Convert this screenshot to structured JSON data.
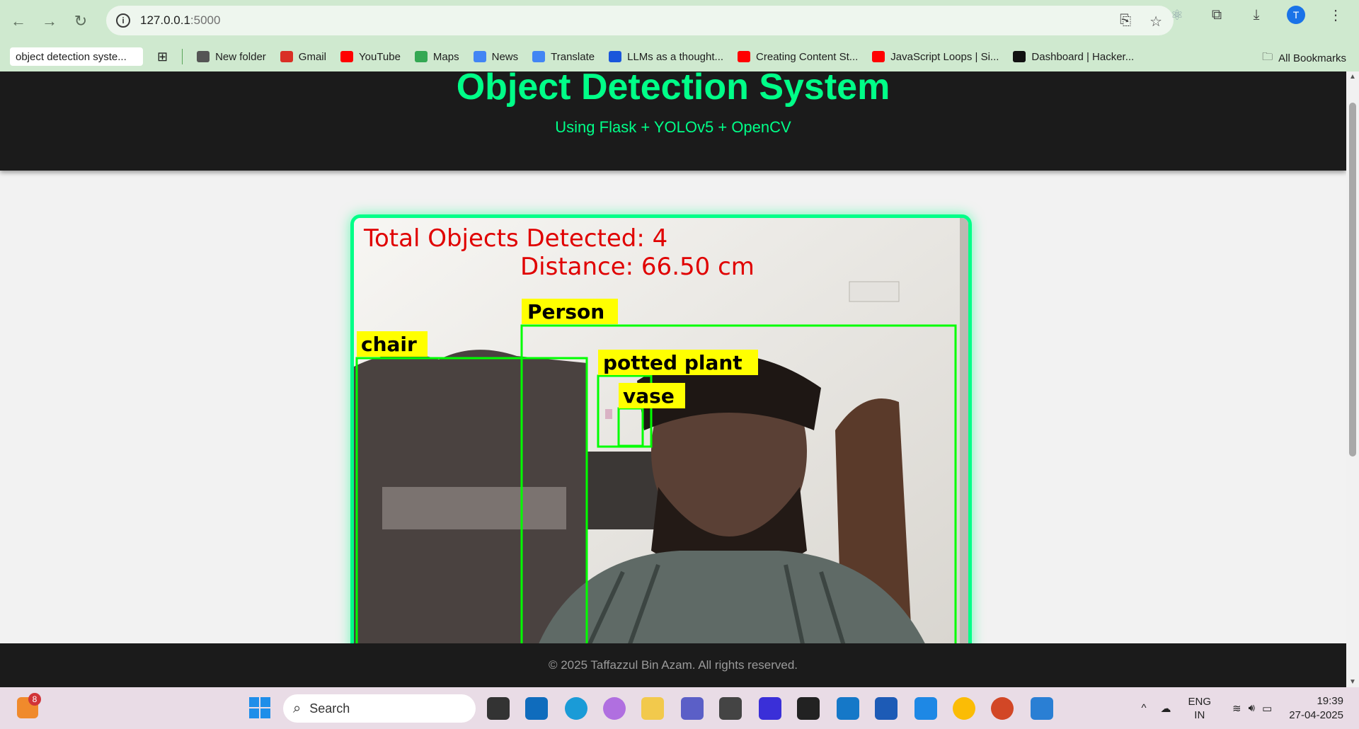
{
  "browser": {
    "url_host": "127.0.0.1",
    "url_port": ":5000",
    "tab_chip": "object detection syste...",
    "avatar_letter": "T",
    "bookmarks": [
      {
        "label": "New folder",
        "icon": "folder-icon",
        "color": "#555555"
      },
      {
        "label": "Gmail",
        "icon": "gmail-icon",
        "color": "#d93025"
      },
      {
        "label": "YouTube",
        "icon": "youtube-icon",
        "color": "#ff0000"
      },
      {
        "label": "Maps",
        "icon": "maps-icon",
        "color": "#34a853"
      },
      {
        "label": "News",
        "icon": "news-icon",
        "color": "#4285f4"
      },
      {
        "label": "Translate",
        "icon": "translate-icon",
        "color": "#4285f4"
      },
      {
        "label": "LLMs as a thought...",
        "icon": "c-logo-icon",
        "color": "#1a56db"
      },
      {
        "label": "Creating Content St...",
        "icon": "youtube-icon",
        "color": "#ff0000"
      },
      {
        "label": "JavaScript Loops | Si...",
        "icon": "youtube-icon",
        "color": "#ff0000"
      },
      {
        "label": "Dashboard | Hacker...",
        "icon": "hackerrank-icon",
        "color": "#111111"
      }
    ],
    "all_bookmarks": "All Bookmarks"
  },
  "page": {
    "title": "Object Detection System",
    "subtitle": "Using Flask + YOLOv5 + OpenCV",
    "footer": "© 2025 Taffazzul Bin Azam. All rights reserved.",
    "accent": "#00ff88"
  },
  "feed": {
    "total_text": "Total Objects Detected: 4",
    "distance_text": "Distance: 66.50 cm",
    "labels": {
      "person": "Person",
      "chair": "chair",
      "potted_plant": "potted plant",
      "vase": "vase"
    },
    "box_color": "#00ff00",
    "label_bg": "#ffff00",
    "text_color": "#e00000"
  },
  "taskbar": {
    "search_placeholder": "Search",
    "notif_count": "8",
    "lang_top": "ENG",
    "lang_bottom": "IN",
    "time": "19:39",
    "date": "27-04-2025"
  }
}
